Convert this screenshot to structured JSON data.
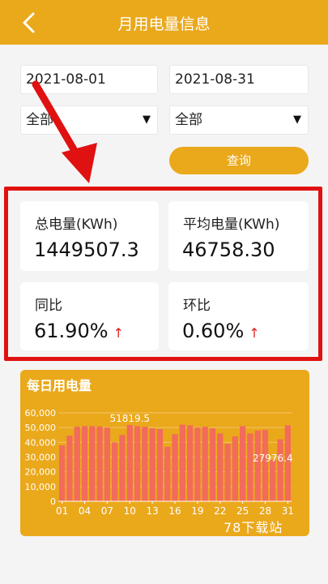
{
  "header": {
    "title": "月用电量信息"
  },
  "filters": {
    "start_date": "2021-08-01",
    "end_date": "2021-08-31",
    "select_left": "全部",
    "select_right": "全部",
    "query_label": "查询"
  },
  "stats": {
    "total_label": "总电量(KWh)",
    "total_value": "1449507.3",
    "avg_label": "平均电量(KWh)",
    "avg_value": "46758.30",
    "yoy_label": "同比",
    "yoy_value": "61.90%",
    "mom_label": "环比",
    "mom_value": "0.60%"
  },
  "colors": {
    "accent": "#EAA81B",
    "bar": "#F26B5B",
    "highlight": "#E01111"
  },
  "watermark": "78下载站",
  "chart_data": {
    "type": "bar",
    "title": "每日用电量",
    "categories": [
      "01",
      "02",
      "03",
      "04",
      "05",
      "06",
      "07",
      "08",
      "09",
      "10",
      "11",
      "12",
      "13",
      "14",
      "15",
      "16",
      "17",
      "18",
      "19",
      "20",
      "21",
      "22",
      "23",
      "24",
      "25",
      "26",
      "27",
      "28",
      "29",
      "30",
      "31"
    ],
    "xticks": [
      "01",
      "04",
      "07",
      "10",
      "13",
      "16",
      "19",
      "22",
      "25",
      "28",
      "31"
    ],
    "values": [
      38000,
      44500,
      50500,
      51000,
      51000,
      50800,
      50000,
      40000,
      45000,
      51819.5,
      51000,
      50500,
      49500,
      49000,
      37000,
      45500,
      52000,
      51500,
      50000,
      50500,
      49500,
      46000,
      39000,
      44000,
      51000,
      46000,
      48000,
      48500,
      27976.4,
      42000,
      51500
    ],
    "labels": [
      {
        "category": "10",
        "text": "51819.5"
      },
      {
        "category": "29",
        "text": "27976.4"
      }
    ],
    "ylim": [
      0,
      60000
    ],
    "yticks": [
      "0",
      "10,000",
      "20,000",
      "30,000",
      "40,000",
      "50,000",
      "60,000"
    ],
    "grid": true
  }
}
